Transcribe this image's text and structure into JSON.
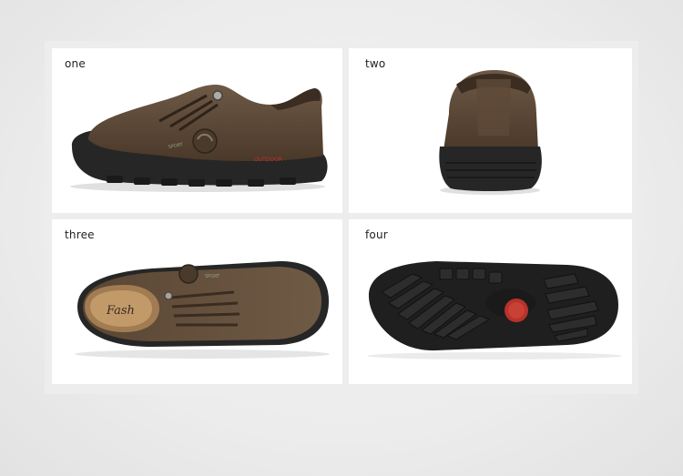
{
  "panels": [
    {
      "label": "one",
      "view": "side"
    },
    {
      "label": "two",
      "view": "back"
    },
    {
      "label": "three",
      "view": "top"
    },
    {
      "label": "four",
      "view": "sole"
    }
  ],
  "shoe": {
    "insole_text": "Fash",
    "side_print": "OUTDOOR",
    "colors": {
      "leather": "#5a4634",
      "sole": "#252525",
      "lining": "#a17c52",
      "accent": "#b8322a"
    }
  }
}
